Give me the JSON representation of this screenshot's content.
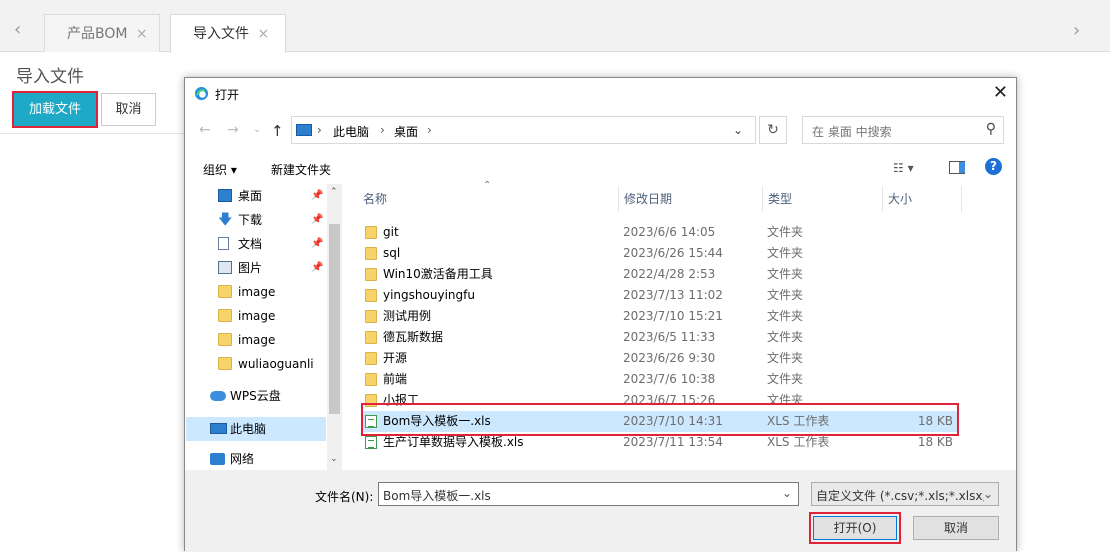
{
  "app": {
    "tabs": [
      {
        "label": "产品BOM",
        "close": "×"
      },
      {
        "label": "导入文件",
        "close": "×"
      }
    ],
    "nav_left": "‹",
    "nav_right": "›",
    "page_title": "导入文件",
    "load_button": "加载文件",
    "cancel_button": "取消",
    "accent_color": "#1ea9c7",
    "highlight_color": "#e0223a"
  },
  "dialog": {
    "title": "打开",
    "close": "✕",
    "address": {
      "segments": [
        "此电脑",
        "桌面"
      ]
    },
    "search_placeholder": "在 桌面 中搜索",
    "toolbar": {
      "organize": "组织 ▾",
      "new_folder": "新建文件夹"
    },
    "nav_items": [
      {
        "label": "桌面",
        "icon": "desktop-icon",
        "pinned": true
      },
      {
        "label": "下载",
        "icon": "download-icon",
        "pinned": true
      },
      {
        "label": "文档",
        "icon": "document-icon",
        "pinned": true
      },
      {
        "label": "图片",
        "icon": "picture-icon",
        "pinned": true
      },
      {
        "label": "image",
        "icon": "folder-icon",
        "pinned": false
      },
      {
        "label": "image",
        "icon": "folder-icon",
        "pinned": false
      },
      {
        "label": "image",
        "icon": "folder-icon",
        "pinned": false
      },
      {
        "label": "wuliaoguanli",
        "icon": "folder-icon",
        "pinned": false
      },
      {
        "label": "WPS云盘",
        "icon": "cloud-icon",
        "pinned": false
      },
      {
        "label": "此电脑",
        "icon": "computer-icon",
        "pinned": false,
        "selected": true
      },
      {
        "label": "网络",
        "icon": "network-icon",
        "pinned": false
      }
    ],
    "columns": {
      "name": "名称",
      "modified": "修改日期",
      "type": "类型",
      "size": "大小"
    },
    "files": [
      {
        "name": "git",
        "date": "2023/6/6 14:05",
        "type": "文件夹",
        "size": "",
        "kind": "folder"
      },
      {
        "name": "sql",
        "date": "2023/6/26 15:44",
        "type": "文件夹",
        "size": "",
        "kind": "folder"
      },
      {
        "name": "Win10激活备用工具",
        "date": "2022/4/28 2:53",
        "type": "文件夹",
        "size": "",
        "kind": "folder"
      },
      {
        "name": "yingshouyingfu",
        "date": "2023/7/13 11:02",
        "type": "文件夹",
        "size": "",
        "kind": "folder"
      },
      {
        "name": "测试用例",
        "date": "2023/7/10 15:21",
        "type": "文件夹",
        "size": "",
        "kind": "folder"
      },
      {
        "name": "德瓦斯数据",
        "date": "2023/6/5 11:33",
        "type": "文件夹",
        "size": "",
        "kind": "folder"
      },
      {
        "name": "开源",
        "date": "2023/6/26 9:30",
        "type": "文件夹",
        "size": "",
        "kind": "folder"
      },
      {
        "name": "前端",
        "date": "2023/7/6 10:38",
        "type": "文件夹",
        "size": "",
        "kind": "folder"
      },
      {
        "name": "小报工",
        "date": "2023/6/7 15:26",
        "type": "文件夹",
        "size": "",
        "kind": "folder"
      },
      {
        "name": "Bom导入模板一.xls",
        "date": "2023/7/10 14:31",
        "type": "XLS 工作表",
        "size": "18 KB",
        "kind": "xls",
        "selected": true
      },
      {
        "name": "生产订单数据导入模板.xls",
        "date": "2023/7/11 13:54",
        "type": "XLS 工作表",
        "size": "18 KB",
        "kind": "xls"
      }
    ],
    "filename_label": "文件名(N):",
    "filename_value": "Bom导入模板一.xls",
    "filter_value": "自定义文件 (*.csv;*.xls;*.xlsx;*.",
    "open_button": "打开(O)",
    "cancel_button": "取消"
  }
}
